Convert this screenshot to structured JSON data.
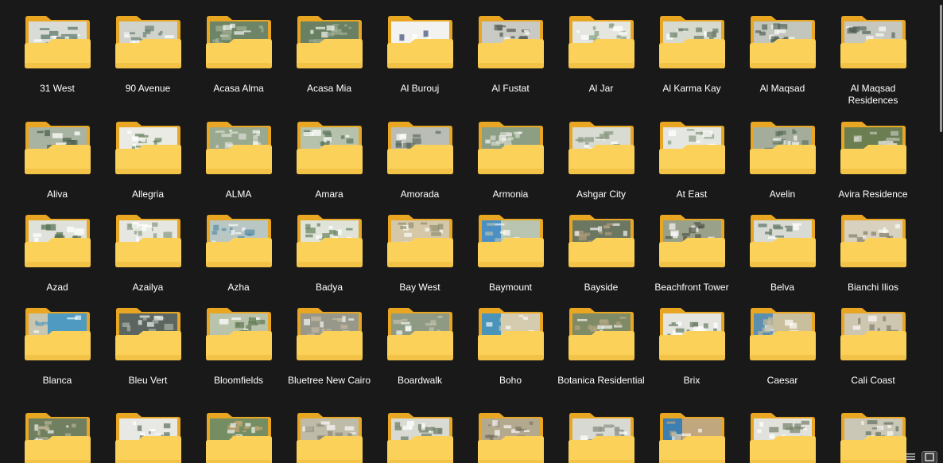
{
  "folders": [
    {
      "name": "31 West",
      "preview": {
        "bg": "#d9dcd6",
        "accent": "#5e7a6a",
        "style": "white"
      }
    },
    {
      "name": "90 Avenue",
      "preview": {
        "bg": "#cfd3cc",
        "accent": "#70847a",
        "style": "white"
      }
    },
    {
      "name": "Acasa Alma",
      "preview": {
        "bg": "#6e8466",
        "accent": "#a9b59c",
        "style": "aerial"
      }
    },
    {
      "name": "Acasa Mia",
      "preview": {
        "bg": "#6a8063",
        "accent": "#a3b09a",
        "style": "aerial"
      }
    },
    {
      "name": "Al Burouj",
      "preview": {
        "bg": "#f2f2f0",
        "accent": "#2d3f6b",
        "style": "doc"
      }
    },
    {
      "name": "Al Fustat",
      "preview": {
        "bg": "#c9cac3",
        "accent": "#59605a",
        "style": "white"
      }
    },
    {
      "name": "Al Jar",
      "preview": {
        "bg": "#e4e6df",
        "accent": "#8ea386",
        "style": "white"
      }
    },
    {
      "name": "Al Karma Kay",
      "preview": {
        "bg": "#d6dacf",
        "accent": "#6e806a",
        "style": "white"
      }
    },
    {
      "name": "Al Maqsad",
      "preview": {
        "bg": "#c3c6bd",
        "accent": "#4b5c51",
        "style": "map"
      }
    },
    {
      "name": "Al Maqsad Residences",
      "preview": {
        "bg": "#c6c8bf",
        "accent": "#4f5e55",
        "style": "map"
      }
    },
    {
      "name": "Aliva",
      "preview": {
        "bg": "#a9b3a1",
        "accent": "#4d6152",
        "style": "white"
      }
    },
    {
      "name": "Allegria",
      "preview": {
        "bg": "#e9ebe4",
        "accent": "#6f8a67",
        "style": "white"
      }
    },
    {
      "name": "ALMA",
      "preview": {
        "bg": "#98a98f",
        "accent": "#e2e4dc",
        "style": "aerial"
      }
    },
    {
      "name": "Amara",
      "preview": {
        "bg": "#b7c2ad",
        "accent": "#5f7860",
        "style": "white"
      }
    },
    {
      "name": "Amorada",
      "preview": {
        "bg": "#b9bdb5",
        "accent": "#56655b",
        "style": "aerial"
      }
    },
    {
      "name": "Armonia",
      "preview": {
        "bg": "#8c9e84",
        "accent": "#dcdfd6",
        "style": "aerial"
      }
    },
    {
      "name": "Ashgar City",
      "preview": {
        "bg": "#d8dbd2",
        "accent": "#8b9a83",
        "style": "white"
      }
    },
    {
      "name": "At East",
      "preview": {
        "bg": "#e4e6e1",
        "accent": "#8da088",
        "style": "white"
      }
    },
    {
      "name": "Avelin",
      "preview": {
        "bg": "#a4ad9b",
        "accent": "#596e5b",
        "style": "aerial"
      }
    },
    {
      "name": "Avira Residence",
      "preview": {
        "bg": "#6a7e52",
        "accent": "#c8c9bd",
        "style": "aerial"
      }
    },
    {
      "name": "Azad",
      "preview": {
        "bg": "#dfe2da",
        "accent": "#5b7357",
        "style": "white"
      }
    },
    {
      "name": "Azailya",
      "preview": {
        "bg": "#e6e7e1",
        "accent": "#8c9c85",
        "style": "white"
      }
    },
    {
      "name": "Azha",
      "preview": {
        "bg": "#b9c7c4",
        "accent": "#4f88a4",
        "style": "aerial"
      }
    },
    {
      "name": "Badya",
      "preview": {
        "bg": "#dfe3d8",
        "accent": "#6e8866",
        "style": "white"
      }
    },
    {
      "name": "Bay West",
      "preview": {
        "bg": "#d4c8a9",
        "accent": "#8c8a6d",
        "style": "map"
      }
    },
    {
      "name": "Baymount",
      "preview": {
        "bg": "#4b8fc4",
        "accent": "#b9c5b0",
        "style": "sea"
      }
    },
    {
      "name": "Bayside",
      "preview": {
        "bg": "#6c7762",
        "accent": "#b7a27c",
        "style": "aerial"
      }
    },
    {
      "name": "Beachfront Tower",
      "preview": {
        "bg": "#9aa18a",
        "accent": "#494f45",
        "style": "aerial"
      }
    },
    {
      "name": "Belva",
      "preview": {
        "bg": "#d8dbd3",
        "accent": "#65796b",
        "style": "white"
      }
    },
    {
      "name": "Bianchi Ilios",
      "preview": {
        "bg": "#d8d1bf",
        "accent": "#7b7866",
        "style": "map"
      }
    },
    {
      "name": "Blanca",
      "preview": {
        "bg": "#c8c6b0",
        "accent": "#4e9ac0",
        "style": "sea"
      }
    },
    {
      "name": "Bleu Vert",
      "preview": {
        "bg": "#5b6660",
        "accent": "#b2b9ae",
        "style": "aerial"
      }
    },
    {
      "name": "Bloomfields",
      "preview": {
        "bg": "#b9c2ab",
        "accent": "#667d57",
        "style": "white"
      }
    },
    {
      "name": "Bluetree New Cairo",
      "preview": {
        "bg": "#97978a",
        "accent": "#c9bda4",
        "style": "aerial"
      }
    },
    {
      "name": "Boardwalk",
      "preview": {
        "bg": "#8e9a83",
        "accent": "#c7c2aa",
        "style": "aerial"
      }
    },
    {
      "name": "Boho",
      "preview": {
        "bg": "#4a93b9",
        "accent": "#d5ccb0",
        "style": "sea"
      }
    },
    {
      "name": "Botanica Residential",
      "preview": {
        "bg": "#7f8a66",
        "accent": "#b5a884",
        "style": "aerial"
      }
    },
    {
      "name": "Brix",
      "preview": {
        "bg": "#e3e5de",
        "accent": "#6e8068",
        "style": "white"
      }
    },
    {
      "name": "Caesar",
      "preview": {
        "bg": "#5b8fb0",
        "accent": "#cabf9c",
        "style": "sea"
      }
    },
    {
      "name": "Cali Coast",
      "preview": {
        "bg": "#cdc6b1",
        "accent": "#7c7a66",
        "style": "map"
      }
    },
    {
      "name": "",
      "preview": {
        "bg": "#6f7f5f",
        "accent": "#c0b89a",
        "style": "aerial"
      }
    },
    {
      "name": "",
      "preview": {
        "bg": "#e8e8e4",
        "accent": "#667766",
        "style": "white"
      }
    },
    {
      "name": "",
      "preview": {
        "bg": "#758d62",
        "accent": "#caa977",
        "style": "aerial"
      }
    },
    {
      "name": "",
      "preview": {
        "bg": "#bfbba9",
        "accent": "#8a8673",
        "style": "aerial"
      }
    },
    {
      "name": "",
      "preview": {
        "bg": "#d8dad3",
        "accent": "#70806a",
        "style": "white"
      }
    },
    {
      "name": "",
      "preview": {
        "bg": "#b2a98f",
        "accent": "#7a7260",
        "style": "aerial"
      }
    },
    {
      "name": "",
      "preview": {
        "bg": "#d7d9d2",
        "accent": "#8a8f84",
        "style": "white"
      }
    },
    {
      "name": "",
      "preview": {
        "bg": "#3d7fb0",
        "accent": "#c1a77e",
        "style": "sea"
      }
    },
    {
      "name": "",
      "preview": {
        "bg": "#e2e2dc",
        "accent": "#7b8672",
        "style": "white"
      }
    },
    {
      "name": "",
      "preview": {
        "bg": "#cbc7b6",
        "accent": "#5b6a5c",
        "style": "map"
      }
    }
  ],
  "colors": {
    "folder_back": "#e9a623",
    "folder_front": "#fbd15a",
    "folder_front_dark": "#f3c347",
    "background": "#191919",
    "text": "#ffffff"
  },
  "view_controls": [
    {
      "name": "details-view",
      "icon": "list-icon",
      "active": false
    },
    {
      "name": "large-icons-view",
      "icon": "tiles-icon",
      "active": true
    }
  ]
}
